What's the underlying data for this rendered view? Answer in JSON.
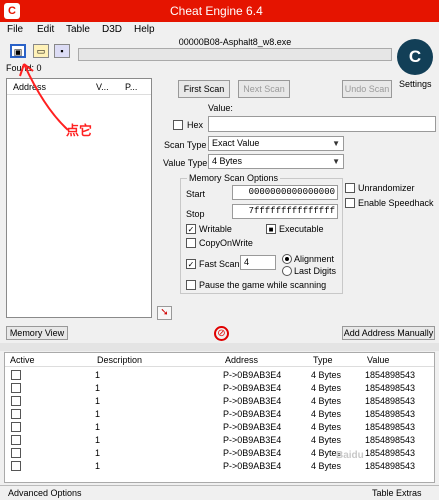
{
  "window": {
    "title": "Cheat Engine 6.4"
  },
  "menu": [
    "File",
    "Edit",
    "Table",
    "D3D",
    "Help"
  ],
  "process": {
    "name": "00000B08-Asphalt8_w8.exe"
  },
  "found": "Found: 0",
  "settings_label": "Settings",
  "address_list": {
    "columns": [
      "Address",
      "V...",
      "P..."
    ]
  },
  "annotation": "点它",
  "scan": {
    "first_scan": "First Scan",
    "next_scan": "Next Scan",
    "undo_scan": "Undo Scan",
    "value_label": "Value:",
    "hex_label": "Hex",
    "scan_type_label": "Scan Type",
    "scan_type_value": "Exact Value",
    "value_type_label": "Value Type",
    "value_type_value": "4 Bytes"
  },
  "memory_options": {
    "title": "Memory Scan Options",
    "start_label": "Start",
    "start_value": "0000000000000000",
    "stop_label": "Stop",
    "stop_value": "7fffffffffffffff",
    "writable": "Writable",
    "executable": "Executable",
    "copy_on_write": "CopyOnWrite",
    "fast_scan": "Fast Scan",
    "fast_scan_value": "4",
    "alignment": "Alignment",
    "last_digits": "Last Digits",
    "pause_game": "Pause the game while scanning"
  },
  "unrandomizer": "Unrandomizer",
  "enable_speedhack": "Enable Speedhack",
  "memory_view": "Memory View",
  "add_address_manually": "Add Address Manually",
  "results": {
    "columns": [
      "Active",
      "Description",
      "Address",
      "Type",
      "Value"
    ],
    "rows": [
      {
        "description": "1",
        "address": "P->0B9AB3E4",
        "type": "4 Bytes",
        "value": "1854898543"
      },
      {
        "description": "1",
        "address": "P->0B9AB3E4",
        "type": "4 Bytes",
        "value": "1854898543"
      },
      {
        "description": "1",
        "address": "P->0B9AB3E4",
        "type": "4 Bytes",
        "value": "1854898543"
      },
      {
        "description": "1",
        "address": "P->0B9AB3E4",
        "type": "4 Bytes",
        "value": "1854898543"
      },
      {
        "description": "1",
        "address": "P->0B9AB3E4",
        "type": "4 Bytes",
        "value": "1854898543"
      },
      {
        "description": "1",
        "address": "P->0B9AB3E4",
        "type": "4 Bytes",
        "value": "1854898543"
      },
      {
        "description": "1",
        "address": "P->0B9AB3E4",
        "type": "4 Bytes",
        "value": "1854898543"
      },
      {
        "description": "1",
        "address": "P->0B9AB3E4",
        "type": "4 Bytes",
        "value": "1854898543"
      }
    ]
  },
  "status": {
    "left": "Advanced Options",
    "right": "Table Extras"
  },
  "watermark": "Baidu"
}
